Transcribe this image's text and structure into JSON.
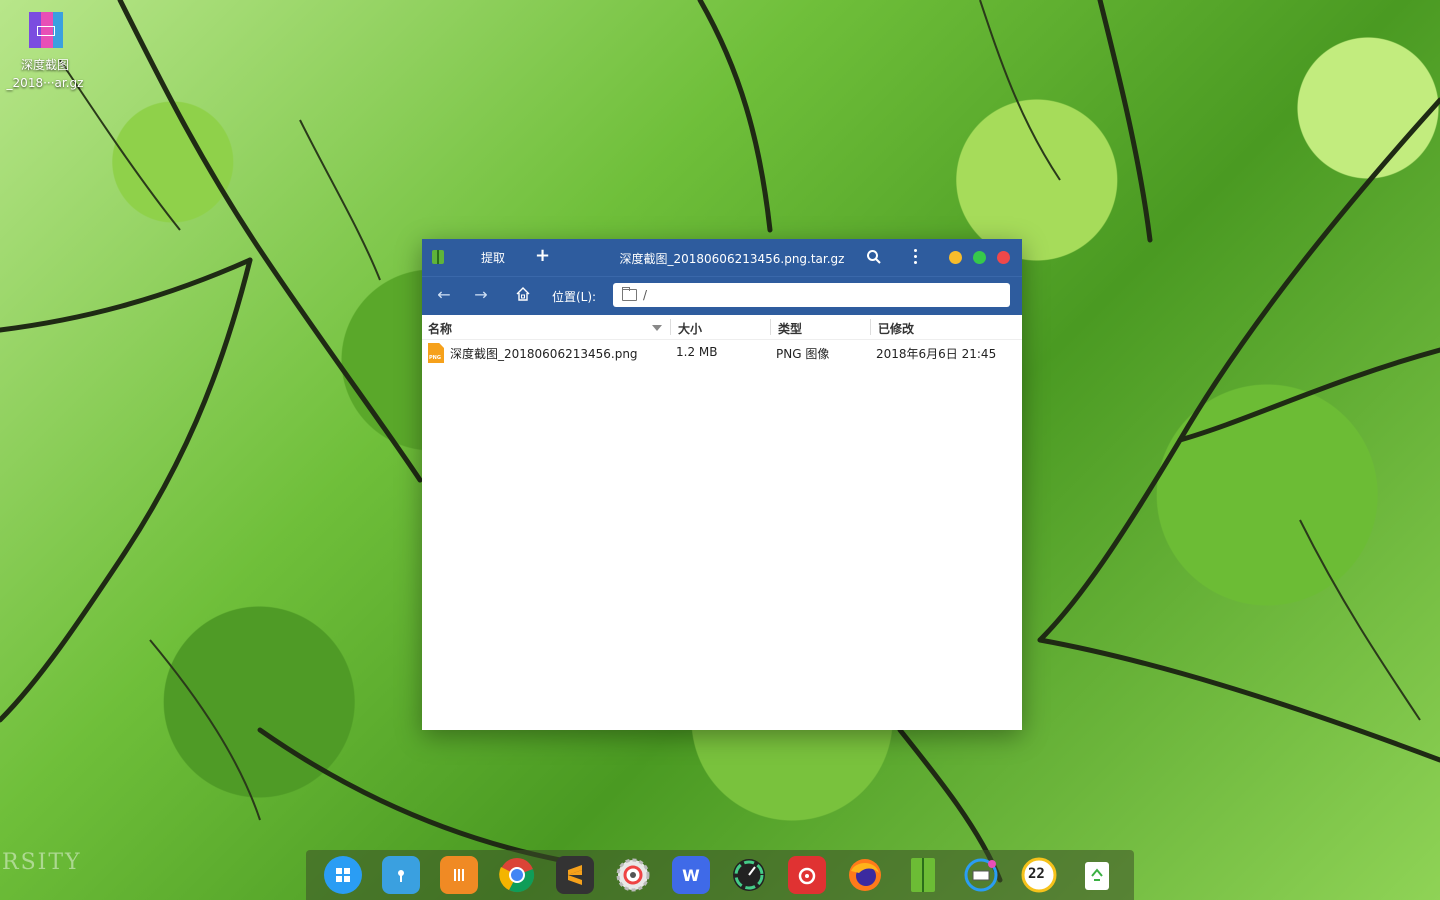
{
  "desktop": {
    "icon_label_line1": "深度截图",
    "icon_label_line2": "_2018···ar.gz",
    "watermark": "RSITY"
  },
  "window": {
    "title": "深度截图_20180606213456.png.tar.gz",
    "extract_label": "提取",
    "add_label": "+",
    "location_label": "位置(L):",
    "location_path": "/",
    "columns": [
      "名称",
      "大小",
      "类型",
      "已修改"
    ],
    "files": [
      {
        "name": "深度截图_20180606213456.png",
        "size": "1.2 MB",
        "type": "PNG 图像",
        "modified": "2018年6月6日 21:45",
        "icon": "PNG"
      }
    ]
  },
  "dock": {
    "items": [
      {
        "name": "launcher-icon",
        "color": "#2a9df4"
      },
      {
        "name": "file-manager-icon",
        "color": "#3aa0e0"
      },
      {
        "name": "app-store-icon",
        "color": "#f08a24"
      },
      {
        "name": "chrome-icon",
        "color": "#ffffff"
      },
      {
        "name": "sublime-text-icon",
        "color": "#333333"
      },
      {
        "name": "settings-icon",
        "color": "#e8e8e8"
      },
      {
        "name": "wps-writer-icon",
        "color": "#3f6ae8"
      },
      {
        "name": "system-monitor-icon",
        "color": "#222222"
      },
      {
        "name": "netease-music-icon",
        "color": "#e03232"
      },
      {
        "name": "firefox-icon",
        "color": "#ff7a1a"
      },
      {
        "name": "archive-manager-icon",
        "color": "#6cbc35"
      },
      {
        "name": "onboard-keyboard-icon",
        "color": "#2a9df4"
      },
      {
        "name": "clock-icon",
        "color": "#ffffff"
      },
      {
        "name": "trash-icon",
        "color": "#ffffff"
      }
    ],
    "clock_text": "22"
  }
}
